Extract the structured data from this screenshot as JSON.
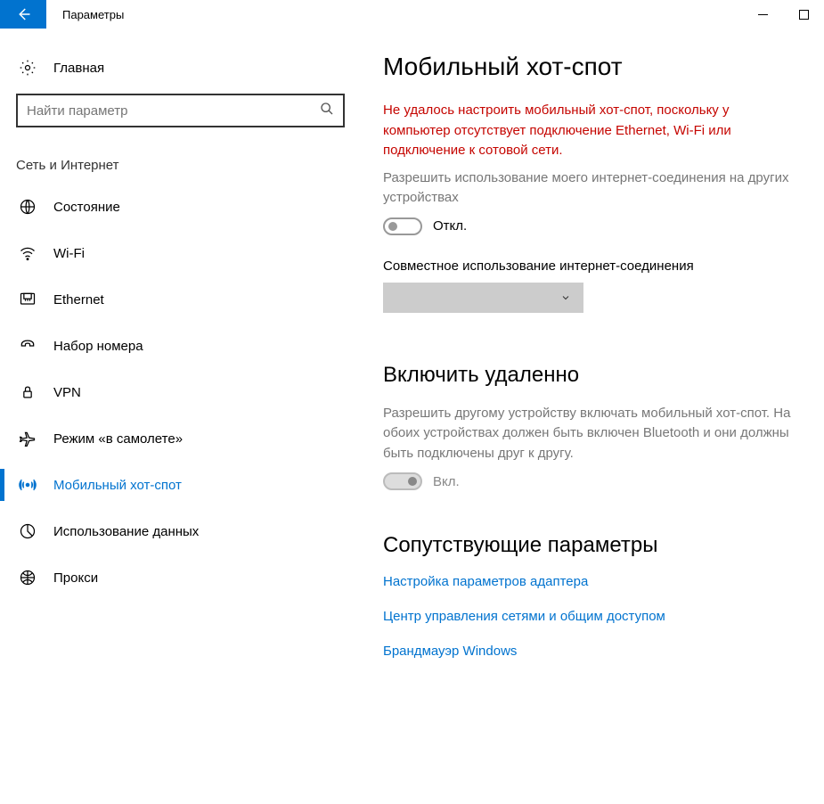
{
  "window": {
    "title": "Параметры"
  },
  "sidebar": {
    "home_label": "Главная",
    "search_placeholder": "Найти параметр",
    "category": "Сеть и Интернет",
    "items": [
      {
        "label": "Состояние"
      },
      {
        "label": "Wi-Fi"
      },
      {
        "label": "Ethernet"
      },
      {
        "label": "Набор номера"
      },
      {
        "label": "VPN"
      },
      {
        "label": "Режим «в самолете»"
      },
      {
        "label": "Мобильный хот-спот"
      },
      {
        "label": "Использование данных"
      },
      {
        "label": "Прокси"
      }
    ]
  },
  "main": {
    "title": "Мобильный хот-спот",
    "error": "Не удалось настроить мобильный хот-спот, поскольку у компьютер отсутствует подключение Ethernet, Wi-Fi или подключение к сотовой сети.",
    "share_desc": "Разрешить использование моего интернет-соединения на других устройствах",
    "toggle1_label": "Откл.",
    "share_from_label": "Совместное использование интернет-соединения",
    "remote_title": "Включить удаленно",
    "remote_desc": "Разрешить другому устройству включать мобильный хот-спот. На обоих устройствах должен быть включен Bluetooth и они должны быть подключены друг к другу.",
    "toggle2_label": "Вкл.",
    "related_title": "Сопутствующие параметры",
    "links": [
      "Настройка параметров адаптера",
      "Центр управления сетями и общим доступом",
      "Брандмауэр Windows"
    ]
  }
}
